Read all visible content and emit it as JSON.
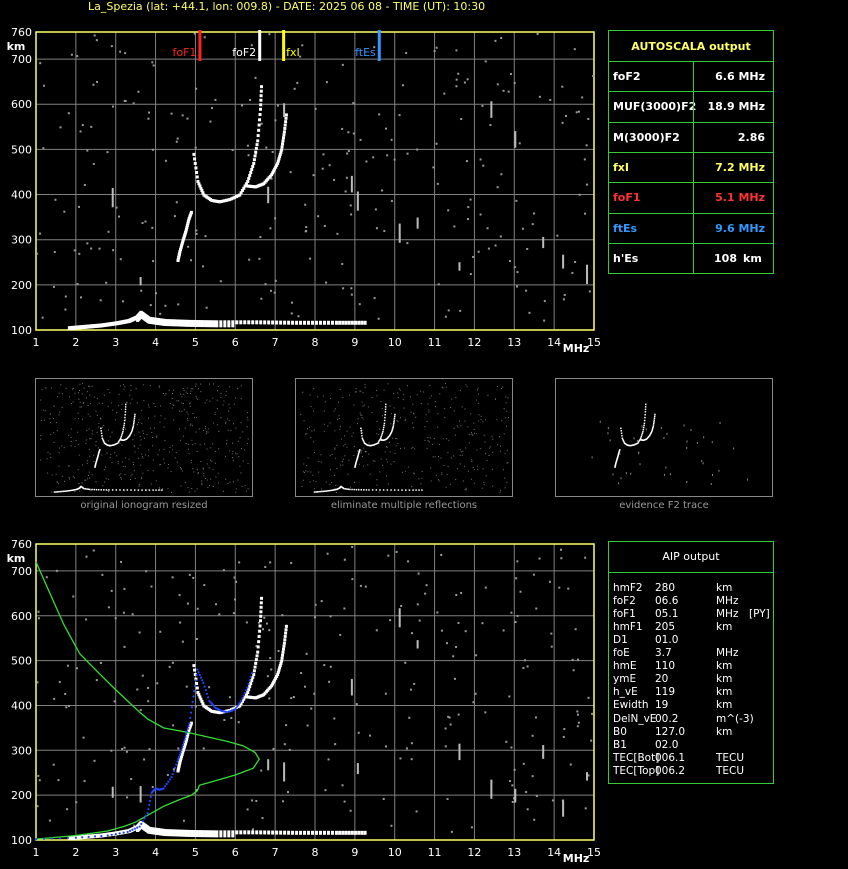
{
  "header": "La_Spezia (lat: +44.1, lon: 009.8) - DATE: 2025 06 08 - TIME (UT): 10:30",
  "colors": {
    "grid": "#808080",
    "axis": "#ffff66",
    "foF1": "#ff2222",
    "foF2": "#ffffff",
    "fxI": "#ffff00",
    "ftEs": "#3399ff",
    "profile": "#33dd33",
    "fit": "#2244ff"
  },
  "autoscala": {
    "title": "AUTOSCALA output",
    "rows": [
      {
        "label": "foF2",
        "value": "6.6 MHz",
        "color": "#ffffff"
      },
      {
        "label": "MUF(3000)F2",
        "value": "18.9 MHz",
        "color": "#ffffff"
      },
      {
        "label": "M(3000)F2",
        "value": "2.86",
        "color": "#ffffff"
      },
      {
        "label": "fxI",
        "value": "7.2 MHz",
        "color": "#ffff66"
      },
      {
        "label": "foF1",
        "value": "5.1 MHz",
        "color": "#ff3333"
      },
      {
        "label": "ftEs",
        "value": "9.6 MHz",
        "color": "#3399ff"
      },
      {
        "label": "h'Es",
        "value": "108",
        "unit": "km",
        "color": "#ffffff"
      }
    ]
  },
  "aip": {
    "title": "AIP output",
    "rows": [
      {
        "name": "hmF2",
        "value": "280",
        "unit": "km",
        "extra": ""
      },
      {
        "name": "foF2",
        "value": "06.6",
        "unit": "MHz",
        "extra": ""
      },
      {
        "name": "foF1",
        "value": "05.1",
        "unit": "MHz",
        "extra": "[PY]"
      },
      {
        "name": "hmF1",
        "value": "205",
        "unit": "km",
        "extra": ""
      },
      {
        "name": "D1",
        "value": "01.0",
        "unit": "",
        "extra": ""
      },
      {
        "name": "foE",
        "value": "3.7",
        "unit": "MHz",
        "extra": ""
      },
      {
        "name": "hmE",
        "value": "110",
        "unit": "km",
        "extra": ""
      },
      {
        "name": "ymE",
        "value": "20",
        "unit": "km",
        "extra": ""
      },
      {
        "name": "h_vE",
        "value": "119",
        "unit": "km",
        "extra": ""
      },
      {
        "name": "Ewidth",
        "value": "19",
        "unit": "km",
        "extra": ""
      },
      {
        "name": "DelN_vE",
        "value": "00.2",
        "unit": "m^(-3)",
        "extra": ""
      },
      {
        "name": "B0",
        "value": "127.0",
        "unit": "km",
        "extra": ""
      },
      {
        "name": "B1",
        "value": "02.0",
        "unit": "",
        "extra": ""
      },
      {
        "name": "TEC[Bot]",
        "value": "006.1",
        "unit": "TECU",
        "extra": ""
      },
      {
        "name": "TEC[Top]",
        "value": "006.2",
        "unit": "TECU",
        "extra": ""
      }
    ]
  },
  "captions": [
    "original ionogram resized",
    "eliminate multiple reflections",
    "evidence F2 trace"
  ],
  "chart_data": [
    {
      "type": "scatter",
      "xlabel": "MHz",
      "ylabel": "km",
      "xlim": [
        1,
        15
      ],
      "ylim": [
        100,
        760
      ],
      "xticks": [
        1,
        2,
        3,
        4,
        5,
        6,
        7,
        8,
        9,
        10,
        11,
        12,
        13,
        14,
        15
      ],
      "yticks": [
        100,
        200,
        300,
        400,
        500,
        600,
        700,
        760
      ],
      "markers": [
        {
          "name": "foF1",
          "x": 5.1,
          "color": "#ff2222"
        },
        {
          "name": "foF2",
          "x": 6.6,
          "color": "#ffffff"
        },
        {
          "name": "fxI",
          "x": 7.2,
          "color": "#ffff00"
        },
        {
          "name": "ftEs",
          "x": 9.6,
          "color": "#3399ff"
        }
      ],
      "traces": {
        "Es": {
          "x": [
            1.8,
            2.2,
            2.6,
            3.0,
            3.3,
            3.5,
            3.6,
            3.8,
            4.2,
            4.8,
            5.5,
            6.5,
            7.5,
            8.5,
            9.3
          ],
          "y": [
            104,
            107,
            110,
            115,
            120,
            128,
            138,
            125,
            120,
            118,
            117,
            117,
            116,
            116,
            116
          ]
        },
        "F1": {
          "x": [
            4.55,
            4.6,
            4.68,
            4.75,
            4.82,
            4.9
          ],
          "y": [
            255,
            275,
            300,
            320,
            345,
            365
          ]
        },
        "F2o": {
          "x": [
            4.95,
            5.05,
            5.2,
            5.4,
            5.6,
            5.85,
            6.1,
            6.3,
            6.45,
            6.55,
            6.62,
            6.65
          ],
          "y": [
            490,
            430,
            400,
            388,
            385,
            390,
            400,
            430,
            470,
            520,
            590,
            650
          ]
        },
        "F2x": {
          "x": [
            6.3,
            6.5,
            6.7,
            6.9,
            7.05,
            7.15,
            7.22,
            7.28
          ],
          "y": [
            420,
            418,
            425,
            445,
            470,
            500,
            540,
            585
          ]
        }
      },
      "noise_columns": [
        2.9,
        3.6,
        6.8,
        7.2,
        8.9,
        9.05,
        10.1,
        10.55,
        11.6,
        12.4,
        13.0,
        13.7,
        14.2,
        14.8
      ]
    },
    {
      "type": "scatter",
      "xlabel": "MHz",
      "ylabel": "km",
      "xlim": [
        1,
        15
      ],
      "ylim": [
        100,
        760
      ],
      "xticks": [
        1,
        2,
        3,
        4,
        5,
        6,
        7,
        8,
        9,
        10,
        11,
        12,
        13,
        14,
        15
      ],
      "yticks": [
        100,
        200,
        300,
        400,
        500,
        600,
        700,
        760
      ],
      "profile": {
        "x": [
          1.0,
          1.3,
          1.7,
          2.1,
          2.6,
          3.0,
          3.3,
          3.6,
          3.8,
          4.2,
          4.8,
          5.3,
          5.8,
          6.2,
          6.5,
          6.6,
          6.45,
          6.0,
          5.5,
          5.1,
          5.05,
          4.9,
          4.6,
          4.2,
          3.9,
          3.7,
          3.6,
          3.5,
          3.2,
          2.8,
          2.0,
          1.0
        ],
        "y": [
          720,
          660,
          580,
          515,
          470,
          435,
          410,
          385,
          370,
          350,
          340,
          330,
          320,
          310,
          295,
          280,
          260,
          245,
          232,
          222,
          210,
          200,
          190,
          175,
          160,
          150,
          145,
          140,
          130,
          120,
          110,
          102
        ]
      },
      "fit": {
        "x": [
          1.0,
          2.0,
          2.8,
          3.3,
          3.6,
          3.8,
          3.9,
          4.0,
          4.1,
          4.2,
          4.4,
          4.55,
          4.65,
          4.75,
          4.85,
          4.95,
          5.05,
          5.2,
          5.35,
          5.5,
          5.65,
          5.8,
          6.0,
          6.15,
          6.3,
          6.45
        ],
        "y": [
          102,
          105,
          110,
          118,
          130,
          160,
          205,
          215,
          212,
          215,
          240,
          275,
          300,
          330,
          360,
          420,
          480,
          450,
          410,
          395,
          388,
          385,
          392,
          410,
          440,
          480
        ]
      },
      "traces_copy": true
    }
  ]
}
